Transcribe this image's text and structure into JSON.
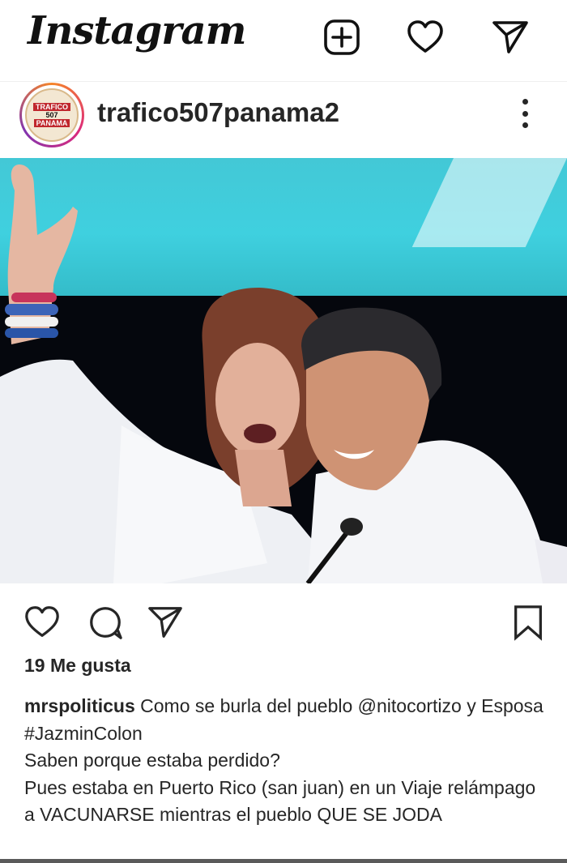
{
  "app": {
    "title": "Instagram"
  },
  "top_icons": [
    "new-post-icon",
    "heart-icon",
    "direct-send-icon"
  ],
  "post": {
    "username": "trafico507panama2",
    "avatar_text": {
      "line1": "TRAFICO",
      "line2": "507",
      "line3": "PANAMA"
    },
    "likes": "19 Me gusta",
    "caption": {
      "user": "mrspoliticus",
      "part1": " Como se burla del pueblo ",
      "mention": "@nitocortizo",
      "part2": " y Esposa ",
      "hashtag": "#JazminColon",
      "line3": "Saben porque estaba perdido?",
      "line4": "Pues estaba en Puerto Rico (san juan) en un Viaje relámpago a VACUNARSE mientras el pueblo QUE SE JODA"
    }
  },
  "colors": {
    "text": "#262626",
    "background": "#ffffff",
    "stage": "#3fd0df"
  }
}
